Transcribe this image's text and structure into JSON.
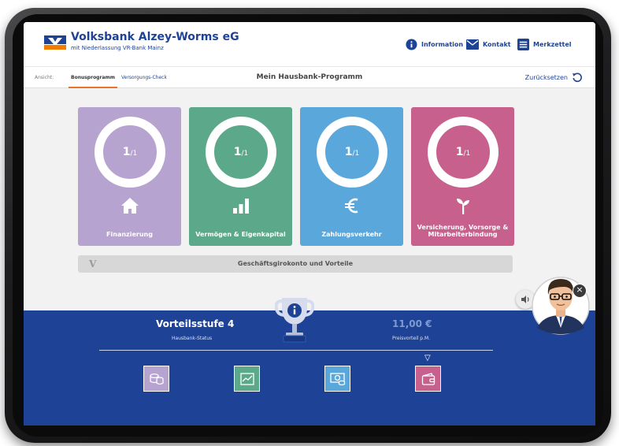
{
  "header": {
    "brand_name": "Volksbank Alzey-Worms eG",
    "brand_sub": "mit Niederlassung VR-Bank Mainz",
    "links": [
      {
        "label": "Information",
        "icon": "info-icon"
      },
      {
        "label": "Kontakt",
        "icon": "mail-icon"
      },
      {
        "label": "Merkzettel",
        "icon": "list-icon"
      }
    ]
  },
  "subnav": {
    "view_label": "Ansicht:",
    "tabs": [
      {
        "label": "Bonusprogramm",
        "active": true
      },
      {
        "label": "Versorgungs-Check",
        "active": false
      }
    ],
    "page_title": "Mein Hausbank-Programm",
    "reset_label": "Zurücksetzen"
  },
  "cards": [
    {
      "value": "1",
      "total": "/1",
      "label": "Finanzierung",
      "color": "#b7a3cf",
      "icon": "house-icon"
    },
    {
      "value": "1",
      "total": "/1",
      "label": "Vermögen & Eigenkapital",
      "color": "#5ba88a",
      "icon": "bar-chart-icon"
    },
    {
      "value": "1",
      "total": "/1",
      "label": "Zahlungsverkehr",
      "color": "#5aa7dc",
      "icon": "euro-icon"
    },
    {
      "value": "1",
      "total": "/1",
      "label": "Versicherung, Vorsorge & Mitarbeiterbindung",
      "color": "#c8608e",
      "icon": "plant-icon"
    }
  ],
  "bar": {
    "label": "Geschäftsgirokonto und Vorteile",
    "logo": "V"
  },
  "panel": {
    "level_title": "Vorteilsstufe 4",
    "level_sub": "Hausbank-Status",
    "price": "11,00 €",
    "price_sub": "Preisvorteil p.M.",
    "tiles": [
      {
        "icon": "coins-icon",
        "color": "#b7a3cf"
      },
      {
        "icon": "chart-icon",
        "color": "#5ba88a"
      },
      {
        "icon": "banknote-icon",
        "color": "#5aa7dc"
      },
      {
        "icon": "wallet-icon",
        "color": "#c8608e"
      }
    ],
    "close_symbol": "×"
  }
}
